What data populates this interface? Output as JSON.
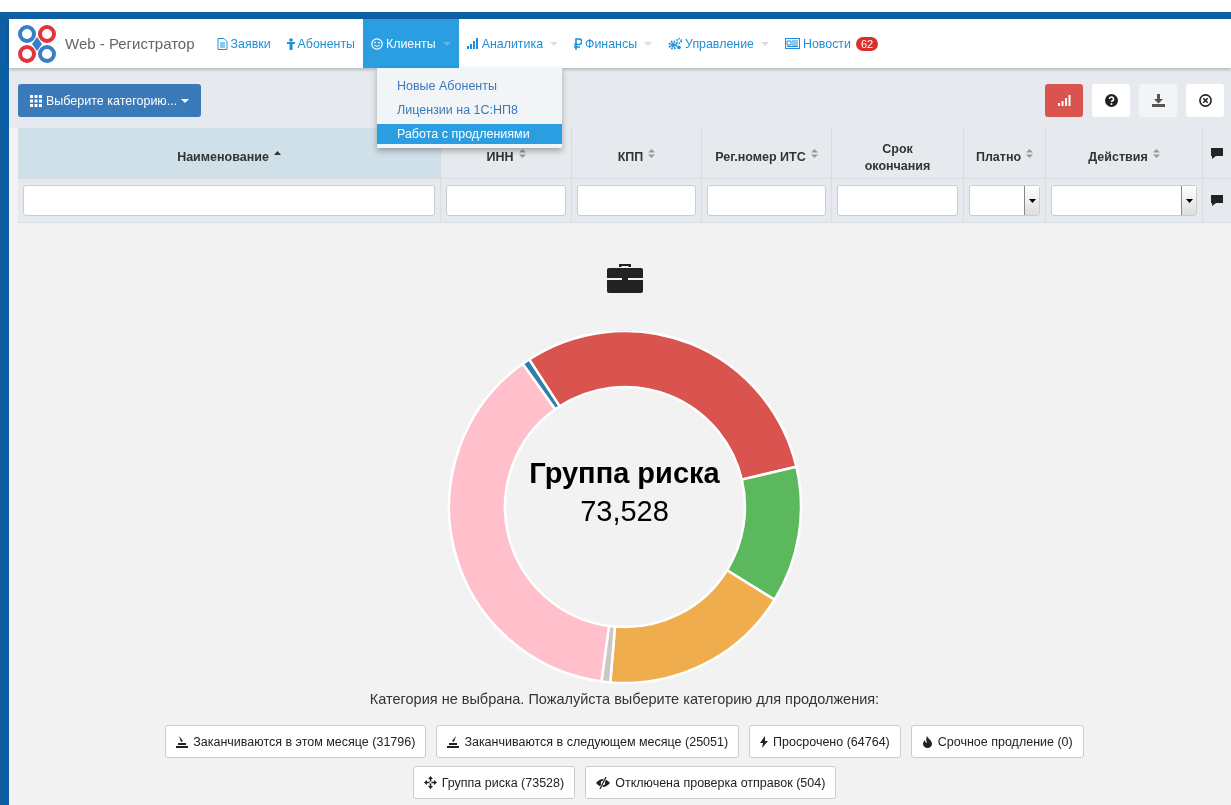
{
  "app": {
    "title": "Web - Регистратор"
  },
  "nav": [
    {
      "label": "Заявки",
      "dropdown": false,
      "selected": false
    },
    {
      "label": "Абоненты",
      "dropdown": false,
      "selected": false
    },
    {
      "label": "Клиенты",
      "dropdown": true,
      "selected": true
    },
    {
      "label": "Аналитика",
      "dropdown": true,
      "selected": false
    },
    {
      "label": "Финансы",
      "dropdown": true,
      "selected": false
    },
    {
      "label": "Управление",
      "dropdown": true,
      "selected": false
    },
    {
      "label": "Новости",
      "dropdown": false,
      "selected": false,
      "badge": "62"
    }
  ],
  "nav_menu": [
    {
      "label": "Новые Абоненты",
      "selected": false
    },
    {
      "label": "Лицензии на 1С:НП8",
      "selected": false
    },
    {
      "label": "Работа с продлениями",
      "selected": true
    }
  ],
  "category_button": {
    "label": "Выберите категорию..."
  },
  "toolbar_buttons": [
    {
      "selected": true,
      "disabled": false
    },
    {
      "selected": false,
      "disabled": false
    },
    {
      "selected": false,
      "disabled": true
    },
    {
      "selected": false,
      "disabled": false
    }
  ],
  "table": {
    "columns": [
      {
        "label": "Наименование",
        "sortable": true,
        "selected": true
      },
      {
        "label": "ИНН",
        "sortable": true,
        "selected": false
      },
      {
        "label": "КПП",
        "sortable": true,
        "selected": false
      },
      {
        "label": "Рег.номер ИТС",
        "sortable": true,
        "selected": false
      },
      {
        "label": "Срок окончания",
        "sortable": false,
        "selected": false
      },
      {
        "label": "Платно",
        "sortable": true,
        "selected": false
      },
      {
        "label": "Действия",
        "sortable": true,
        "selected": false
      }
    ],
    "filters": [
      {
        "kind": "text"
      },
      {
        "kind": "text"
      },
      {
        "kind": "text"
      },
      {
        "kind": "text"
      },
      {
        "kind": "text"
      },
      {
        "kind": "select"
      },
      {
        "kind": "select"
      }
    ]
  },
  "chart": {
    "title": "Группа риска",
    "value": "73,528"
  },
  "prompt": "Категория не выбрана. Пожалуйста выберите категорию для продолжения:",
  "categories": [
    {
      "label": "Заканчиваются в этом месяце (31796)"
    },
    {
      "label": "Заканчиваются в следующем месяце (25051)"
    },
    {
      "label": "Просрочено (64764)"
    },
    {
      "label": "Срочное продление (0)"
    },
    {
      "label": "Группа риска (73528)"
    },
    {
      "label": "Отключена проверка отправок (504)"
    }
  ]
}
